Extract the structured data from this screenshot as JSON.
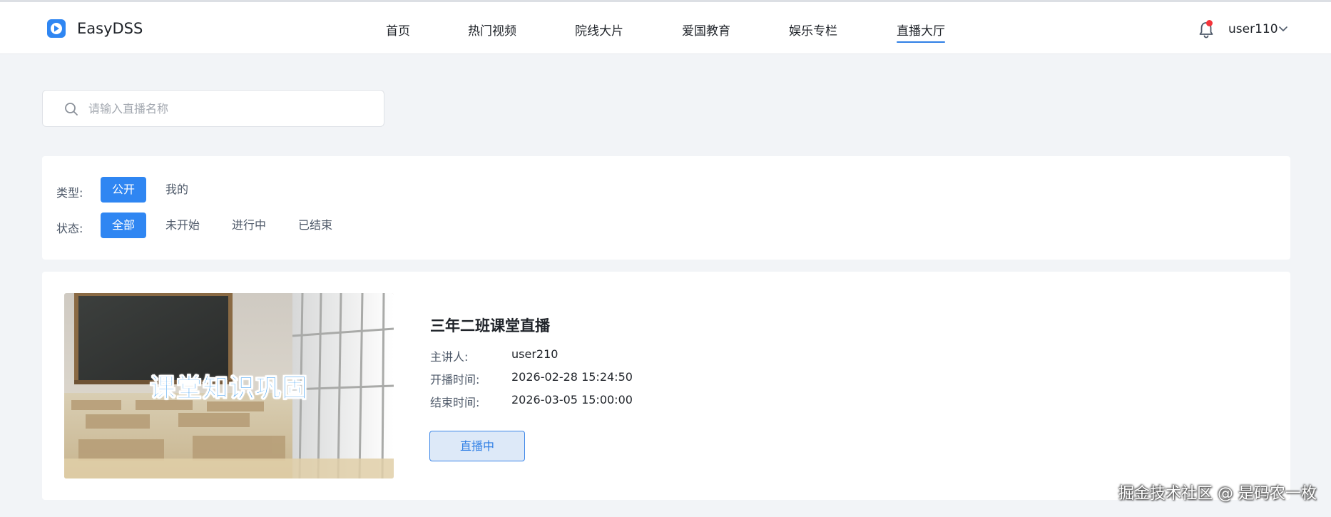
{
  "app": {
    "name": "EasyDSS"
  },
  "nav": {
    "items": [
      {
        "label": "首页"
      },
      {
        "label": "热门视频"
      },
      {
        "label": "院线大片"
      },
      {
        "label": "爱国教育"
      },
      {
        "label": "娱乐专栏"
      },
      {
        "label": "直播大厅",
        "active": true
      }
    ]
  },
  "user": {
    "name": "user110",
    "notifications_unread": true
  },
  "search": {
    "placeholder": "请输入直播名称",
    "value": ""
  },
  "filters": {
    "type": {
      "label": "类型:",
      "options": [
        "公开",
        "我的"
      ],
      "selected": "公开"
    },
    "status": {
      "label": "状态:",
      "options": [
        "全部",
        "未开始",
        "进行中",
        "已结束"
      ],
      "selected": "全部"
    }
  },
  "live": {
    "thumbnail_caption": "课堂知识巩固",
    "title": "三年二班课堂直播",
    "host_label": "主讲人:",
    "host": "user210",
    "start_label": "开播时间:",
    "start_time": "2026-02-28 15:24:50",
    "end_label": "结束时间:",
    "end_time": "2026-03-05 15:00:00",
    "status": "直播中"
  },
  "watermark": "掘金技术社区 @ 是码农一枚",
  "colors": {
    "accent": "#2f86f2",
    "background": "#f2f4f7",
    "notification": "#f5343a"
  }
}
